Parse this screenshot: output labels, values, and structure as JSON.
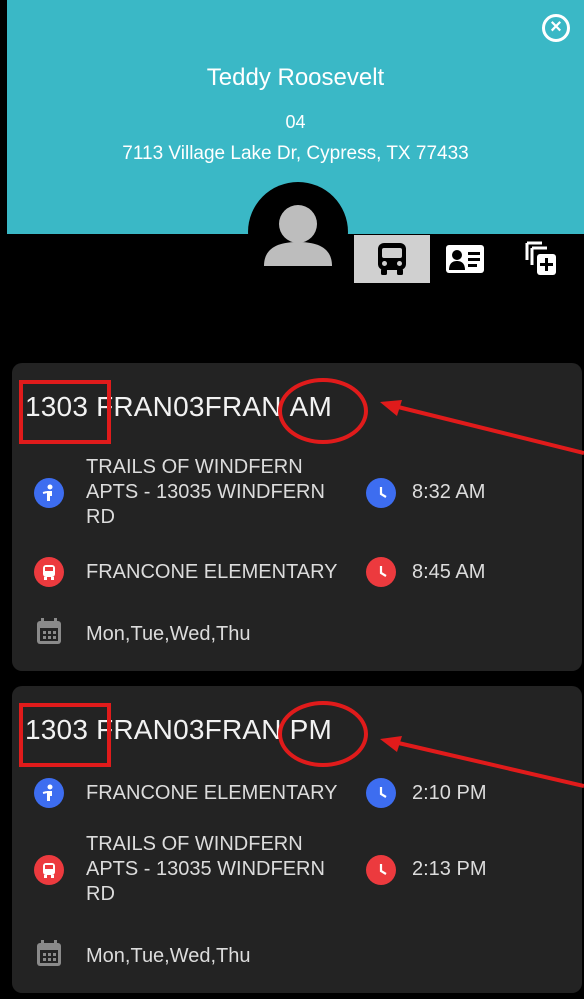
{
  "student": {
    "name": "Teddy Roosevelt",
    "grade": "04",
    "address": "7113 Village Lake Dr, Cypress, TX 77433"
  },
  "close_icon": "close-circle-icon",
  "tabs": [
    {
      "icon": "bus-icon",
      "active": true
    },
    {
      "icon": "id-card-icon",
      "active": false
    },
    {
      "icon": "add-copy-icon",
      "active": false
    }
  ],
  "routes": [
    {
      "number": "1303",
      "name": "FRAN03FRAN",
      "period": "AM",
      "pickup": {
        "icon": "pickup-person-icon",
        "stop": "TRAILS OF WINDFERN APTS - 13035 WINDFERN RD",
        "time": "8:32 AM"
      },
      "dropoff": {
        "icon": "bus-stop-icon",
        "stop": "FRANCONE ELEMENTARY",
        "time": "8:45 AM"
      },
      "days": "Mon,Tue,Wed,Thu"
    },
    {
      "number": "1303",
      "name": "FRAN03FRAN",
      "period": "PM",
      "pickup": {
        "icon": "pickup-person-icon",
        "stop": "FRANCONE ELEMENTARY",
        "time": "2:10 PM"
      },
      "dropoff": {
        "icon": "bus-stop-icon",
        "stop": "TRAILS OF WINDFERN APTS - 13035 WINDFERN RD",
        "time": "2:13 PM"
      },
      "days": "Mon,Tue,Wed,Thu"
    }
  ],
  "colors": {
    "header": "#3ab8c6",
    "card": "#232323",
    "blue": "#3d6df0",
    "red": "#ec3a3e",
    "annotation": "#e01b1b"
  }
}
